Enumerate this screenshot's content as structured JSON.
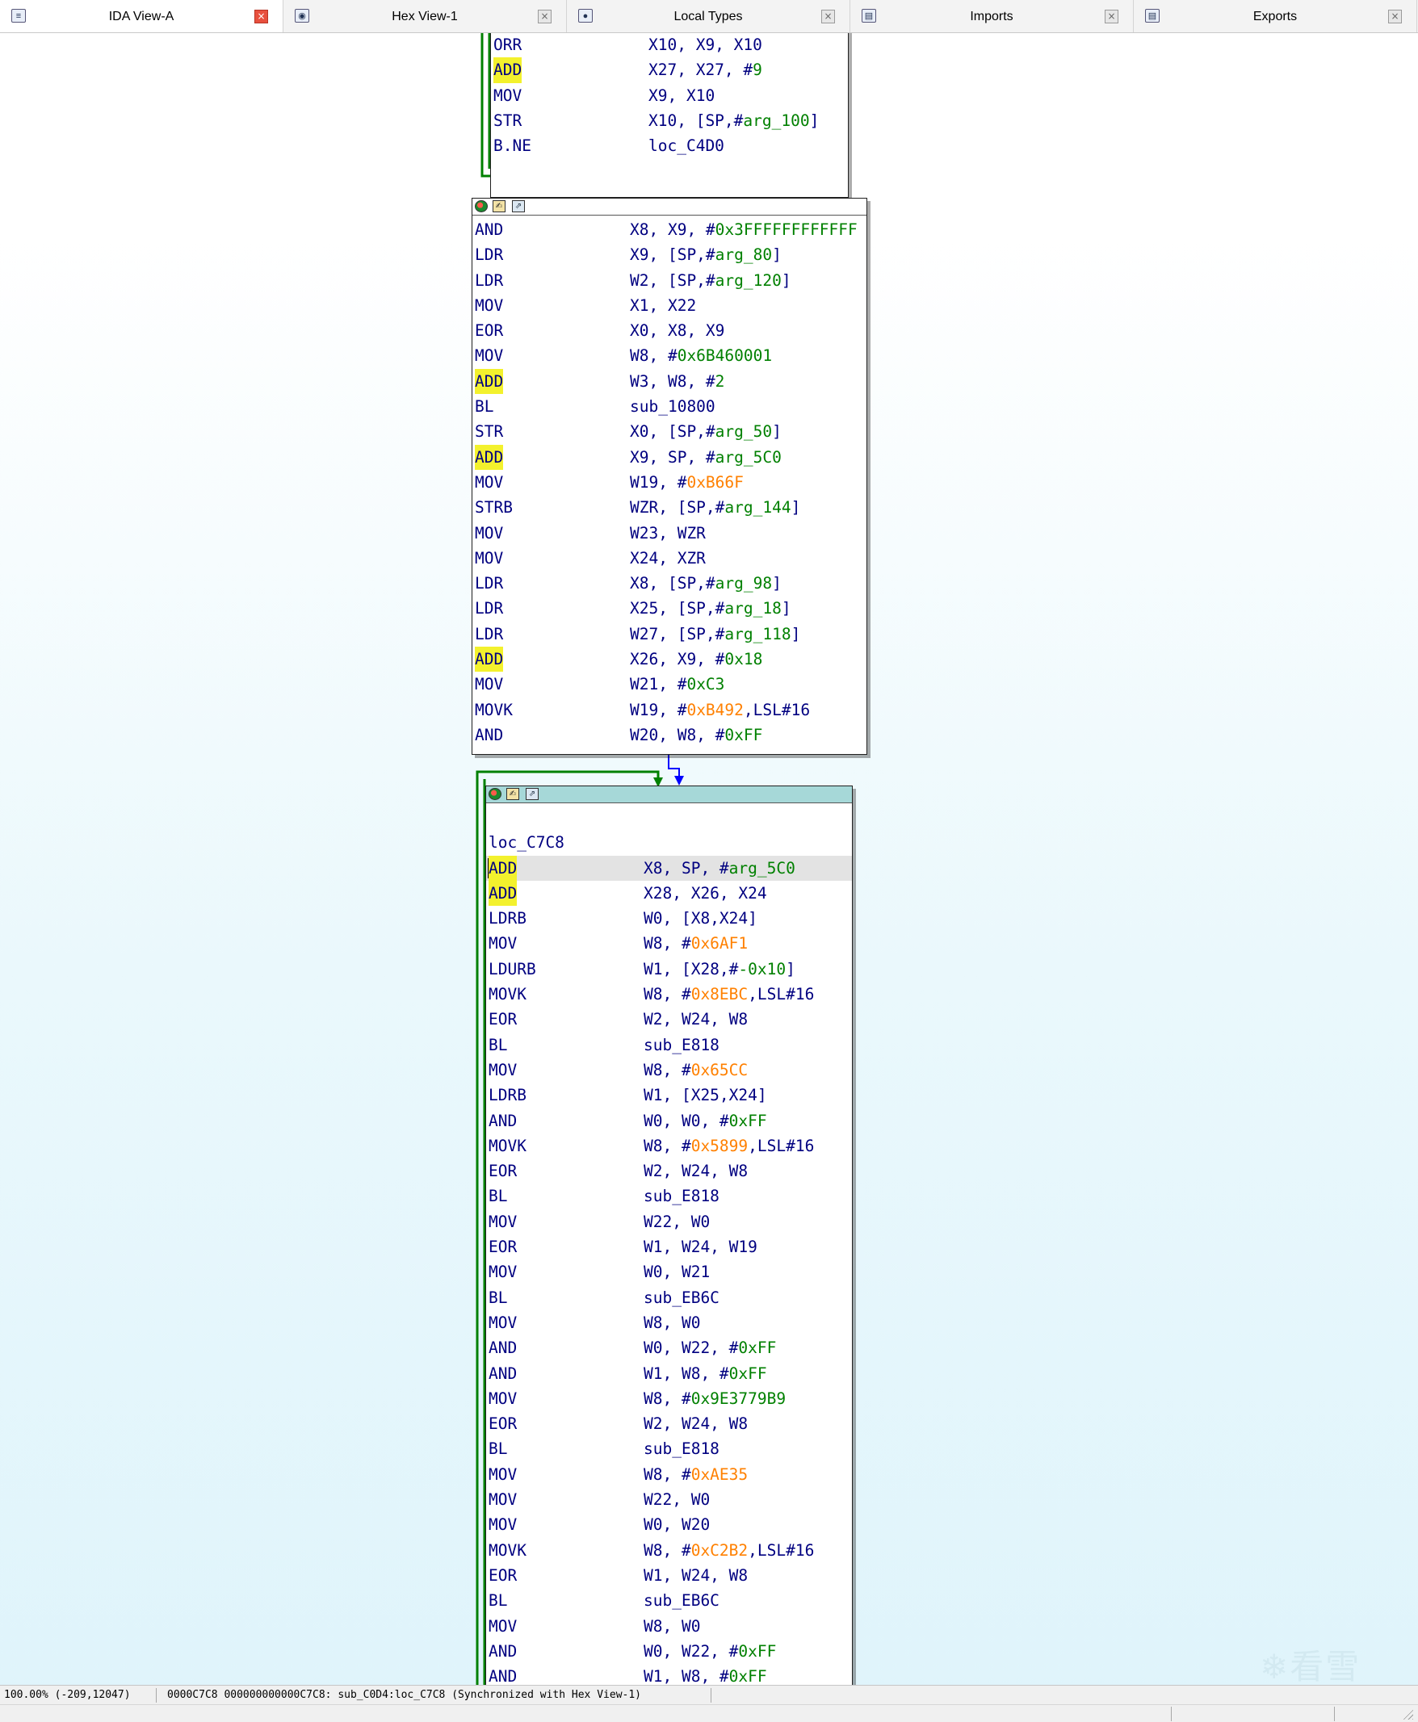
{
  "tabs": [
    {
      "label": "IDA View-A",
      "icon": "ida-view-icon",
      "close": "red",
      "active": true
    },
    {
      "label": "Hex View-1",
      "icon": "hex-view-icon",
      "close": "gray",
      "active": false
    },
    {
      "label": "Local Types",
      "icon": "local-types-icon",
      "close": "gray",
      "active": false
    },
    {
      "label": "Imports",
      "icon": "imports-icon",
      "close": "gray",
      "active": false
    },
    {
      "label": "Exports",
      "icon": "exports-icon",
      "close": "gray",
      "active": false
    }
  ],
  "colors": {
    "mnemonic": "#000080",
    "number": "#008000",
    "constant": "#ff8000",
    "highlight": "#f3f12d",
    "edge_true": "#008000",
    "edge_false": "#ff0000",
    "edge_flow": "#0000ff",
    "selected_title": "#a6d8d8"
  },
  "blocks": [
    {
      "id": "block-top",
      "title_bar": false,
      "lines": [
        {
          "mn": "ORR",
          "ops": [
            "X10, X9, X10"
          ]
        },
        {
          "mn": "ADD",
          "hl": true,
          "ops": [
            "X27, X27, #",
            {
              "t": "9",
              "c": "g"
            }
          ]
        },
        {
          "mn": "MOV",
          "ops": [
            "X9, X10"
          ]
        },
        {
          "mn": "STR",
          "ops": [
            "X10, [SP,#",
            {
              "t": "arg_100",
              "c": "g"
            },
            "]"
          ]
        },
        {
          "mn": "B.NE",
          "ops": [
            "loc_C4D0"
          ]
        }
      ]
    },
    {
      "id": "block-middle",
      "title_bar": true,
      "lines": [
        {
          "mn": "AND",
          "ops": [
            "X8, X9, #",
            {
              "t": "0x3FFFFFFFFFFFF",
              "c": "g"
            }
          ]
        },
        {
          "mn": "LDR",
          "ops": [
            "X9, [SP,#",
            {
              "t": "arg_80",
              "c": "g"
            },
            "]"
          ]
        },
        {
          "mn": "LDR",
          "ops": [
            "W2, [SP,#",
            {
              "t": "arg_120",
              "c": "g"
            },
            "]"
          ]
        },
        {
          "mn": "MOV",
          "ops": [
            "X1, X22"
          ]
        },
        {
          "mn": "EOR",
          "ops": [
            "X0, X8, X9"
          ]
        },
        {
          "mn": "MOV",
          "ops": [
            "W8, #",
            {
              "t": "0x6B460001",
              "c": "g"
            }
          ]
        },
        {
          "mn": "ADD",
          "hl": true,
          "ops": [
            "W3, W8, #",
            {
              "t": "2",
              "c": "g"
            }
          ]
        },
        {
          "mn": "BL",
          "ops": [
            "sub_10800"
          ]
        },
        {
          "mn": "STR",
          "ops": [
            "X0, [SP,#",
            {
              "t": "arg_50",
              "c": "g"
            },
            "]"
          ]
        },
        {
          "mn": "ADD",
          "hl": true,
          "ops": [
            "X9, SP, #",
            {
              "t": "arg_5C0",
              "c": "g"
            }
          ]
        },
        {
          "mn": "MOV",
          "ops": [
            "W19, #",
            {
              "t": "0xB66F",
              "c": "o"
            }
          ]
        },
        {
          "mn": "STRB",
          "ops": [
            "WZR, [SP,#",
            {
              "t": "arg_144",
              "c": "g"
            },
            "]"
          ]
        },
        {
          "mn": "MOV",
          "ops": [
            "W23, WZR"
          ]
        },
        {
          "mn": "MOV",
          "ops": [
            "X24, XZR"
          ]
        },
        {
          "mn": "LDR",
          "ops": [
            "X8, [SP,#",
            {
              "t": "arg_98",
              "c": "g"
            },
            "]"
          ]
        },
        {
          "mn": "LDR",
          "ops": [
            "X25, [SP,#",
            {
              "t": "arg_18",
              "c": "g"
            },
            "]"
          ]
        },
        {
          "mn": "LDR",
          "ops": [
            "W27, [SP,#",
            {
              "t": "arg_118",
              "c": "g"
            },
            "]"
          ]
        },
        {
          "mn": "ADD",
          "hl": true,
          "ops": [
            "X26, X9, #",
            {
              "t": "0x18",
              "c": "g"
            }
          ]
        },
        {
          "mn": "MOV",
          "ops": [
            "W21, #",
            {
              "t": "0xC3",
              "c": "g"
            }
          ]
        },
        {
          "mn": "MOVK",
          "ops": [
            "W19, #",
            {
              "t": "0xB492",
              "c": "o"
            },
            ",LSL#16"
          ]
        },
        {
          "mn": "AND",
          "ops": [
            "W20, W8, #",
            {
              "t": "0xFF",
              "c": "g"
            }
          ]
        }
      ]
    },
    {
      "id": "block-loop",
      "title_bar": true,
      "selected": true,
      "label": "loc_C7C8",
      "lines": [
        {
          "mn": "ADD",
          "hl": true,
          "cur": true,
          "ops": [
            "X8, SP, #",
            {
              "t": "arg_5C0",
              "c": "g"
            }
          ]
        },
        {
          "mn": "ADD",
          "hl": true,
          "ops": [
            "X28, X26, X24"
          ]
        },
        {
          "mn": "LDRB",
          "ops": [
            "W0, [X8,X24]"
          ]
        },
        {
          "mn": "MOV",
          "ops": [
            "W8, #",
            {
              "t": "0x6AF1",
              "c": "o"
            }
          ]
        },
        {
          "mn": "LDURB",
          "ops": [
            "W1, [X28,#",
            {
              "t": "-0x10",
              "c": "g"
            },
            "]"
          ]
        },
        {
          "mn": "MOVK",
          "ops": [
            "W8, #",
            {
              "t": "0x8EBC",
              "c": "o"
            },
            ",LSL#16"
          ]
        },
        {
          "mn": "EOR",
          "ops": [
            "W2, W24, W8"
          ]
        },
        {
          "mn": "BL",
          "ops": [
            "sub_E818"
          ]
        },
        {
          "mn": "MOV",
          "ops": [
            "W8, #",
            {
              "t": "0x65CC",
              "c": "o"
            }
          ]
        },
        {
          "mn": "LDRB",
          "ops": [
            "W1, [X25,X24]"
          ]
        },
        {
          "mn": "AND",
          "ops": [
            "W0, W0, #",
            {
              "t": "0xFF",
              "c": "g"
            }
          ]
        },
        {
          "mn": "MOVK",
          "ops": [
            "W8, #",
            {
              "t": "0x5899",
              "c": "o"
            },
            ",LSL#16"
          ]
        },
        {
          "mn": "EOR",
          "ops": [
            "W2, W24, W8"
          ]
        },
        {
          "mn": "BL",
          "ops": [
            "sub_E818"
          ]
        },
        {
          "mn": "MOV",
          "ops": [
            "W22, W0"
          ]
        },
        {
          "mn": "EOR",
          "ops": [
            "W1, W24, W19"
          ]
        },
        {
          "mn": "MOV",
          "ops": [
            "W0, W21"
          ]
        },
        {
          "mn": "BL",
          "ops": [
            "sub_EB6C"
          ]
        },
        {
          "mn": "MOV",
          "ops": [
            "W8, W0"
          ]
        },
        {
          "mn": "AND",
          "ops": [
            "W0, W22, #",
            {
              "t": "0xFF",
              "c": "g"
            }
          ]
        },
        {
          "mn": "AND",
          "ops": [
            "W1, W8, #",
            {
              "t": "0xFF",
              "c": "g"
            }
          ]
        },
        {
          "mn": "MOV",
          "ops": [
            "W8, #",
            {
              "t": "0x9E3779B9",
              "c": "g"
            }
          ]
        },
        {
          "mn": "EOR",
          "ops": [
            "W2, W24, W8"
          ]
        },
        {
          "mn": "BL",
          "ops": [
            "sub_E818"
          ]
        },
        {
          "mn": "MOV",
          "ops": [
            "W8, #",
            {
              "t": "0xAE35",
              "c": "o"
            }
          ]
        },
        {
          "mn": "MOV",
          "ops": [
            "W22, W0"
          ]
        },
        {
          "mn": "MOV",
          "ops": [
            "W0, W20"
          ]
        },
        {
          "mn": "MOVK",
          "ops": [
            "W8, #",
            {
              "t": "0xC2B2",
              "c": "o"
            },
            ",LSL#16"
          ]
        },
        {
          "mn": "EOR",
          "ops": [
            "W1, W24, W8"
          ]
        },
        {
          "mn": "BL",
          "ops": [
            "sub_EB6C"
          ]
        },
        {
          "mn": "MOV",
          "ops": [
            "W8, W0"
          ]
        },
        {
          "mn": "AND",
          "ops": [
            "W0, W22, #",
            {
              "t": "0xFF",
              "c": "g"
            }
          ]
        },
        {
          "mn": "AND",
          "ops": [
            "W1, W8, #",
            {
              "t": "0xFF",
              "c": "g"
            }
          ]
        }
      ]
    }
  ],
  "status": {
    "zoom_coords": "100.00% (-209,12047)",
    "address": "0000C7C8 000000000000C7C8: sub_C0D4:loc_C7C8 (Synchronized with Hex View-1)"
  },
  "watermark": "看雪"
}
